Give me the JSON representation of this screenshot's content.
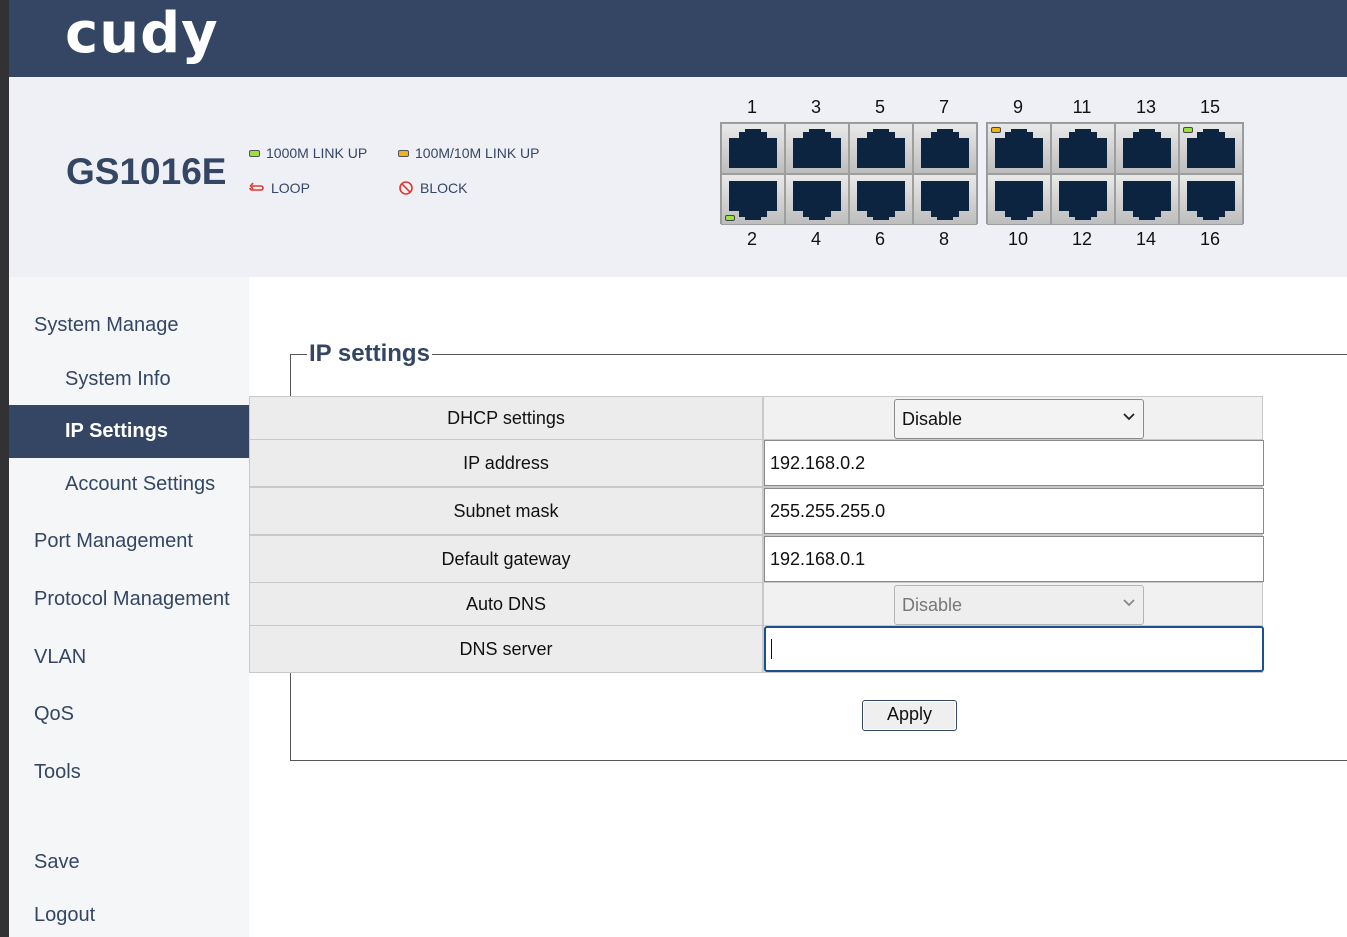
{
  "brand": {
    "logo_text": "cudy"
  },
  "device": {
    "model": "GS1016E"
  },
  "legend": {
    "link_1000m": "1000M LINK UP",
    "link_100m_10m": "100M/10M LINK UP",
    "loop": "LOOP",
    "block": "BLOCK",
    "colors": {
      "green": "#9be13c",
      "orange": "#f2b21b",
      "loop": "#e0382f",
      "block": "#e0382f"
    }
  },
  "ports": {
    "top": [
      "1",
      "3",
      "5",
      "7",
      "9",
      "11",
      "13",
      "15"
    ],
    "bottom": [
      "2",
      "4",
      "6",
      "8",
      "10",
      "12",
      "14",
      "16"
    ],
    "status": {
      "2": "green",
      "9": "orange",
      "15": "green"
    }
  },
  "sidebar": {
    "items": [
      {
        "label": "System Manage",
        "level": "top"
      },
      {
        "label": "System Info",
        "level": "sub"
      },
      {
        "label": "IP Settings",
        "level": "sub",
        "active": true
      },
      {
        "label": "Account Settings",
        "level": "sub"
      },
      {
        "label": "Port Management",
        "level": "top"
      },
      {
        "label": "Protocol Management",
        "level": "top"
      },
      {
        "label": "VLAN",
        "level": "top"
      },
      {
        "label": "QoS",
        "level": "top"
      },
      {
        "label": "Tools",
        "level": "top"
      },
      {
        "label": "Save",
        "level": "top"
      },
      {
        "label": "Logout",
        "level": "top"
      }
    ]
  },
  "ip_settings": {
    "title": "IP settings",
    "rows": {
      "dhcp": {
        "label": "DHCP settings",
        "value": "Disable"
      },
      "ip": {
        "label": "IP address",
        "value": "192.168.0.2"
      },
      "mask": {
        "label": "Subnet mask",
        "value": "255.255.255.0"
      },
      "gateway": {
        "label": "Default gateway",
        "value": "192.168.0.1"
      },
      "auto_dns": {
        "label": "Auto DNS",
        "value": "Disable"
      },
      "dns": {
        "label": "DNS server",
        "value": ""
      }
    },
    "apply_label": "Apply"
  }
}
